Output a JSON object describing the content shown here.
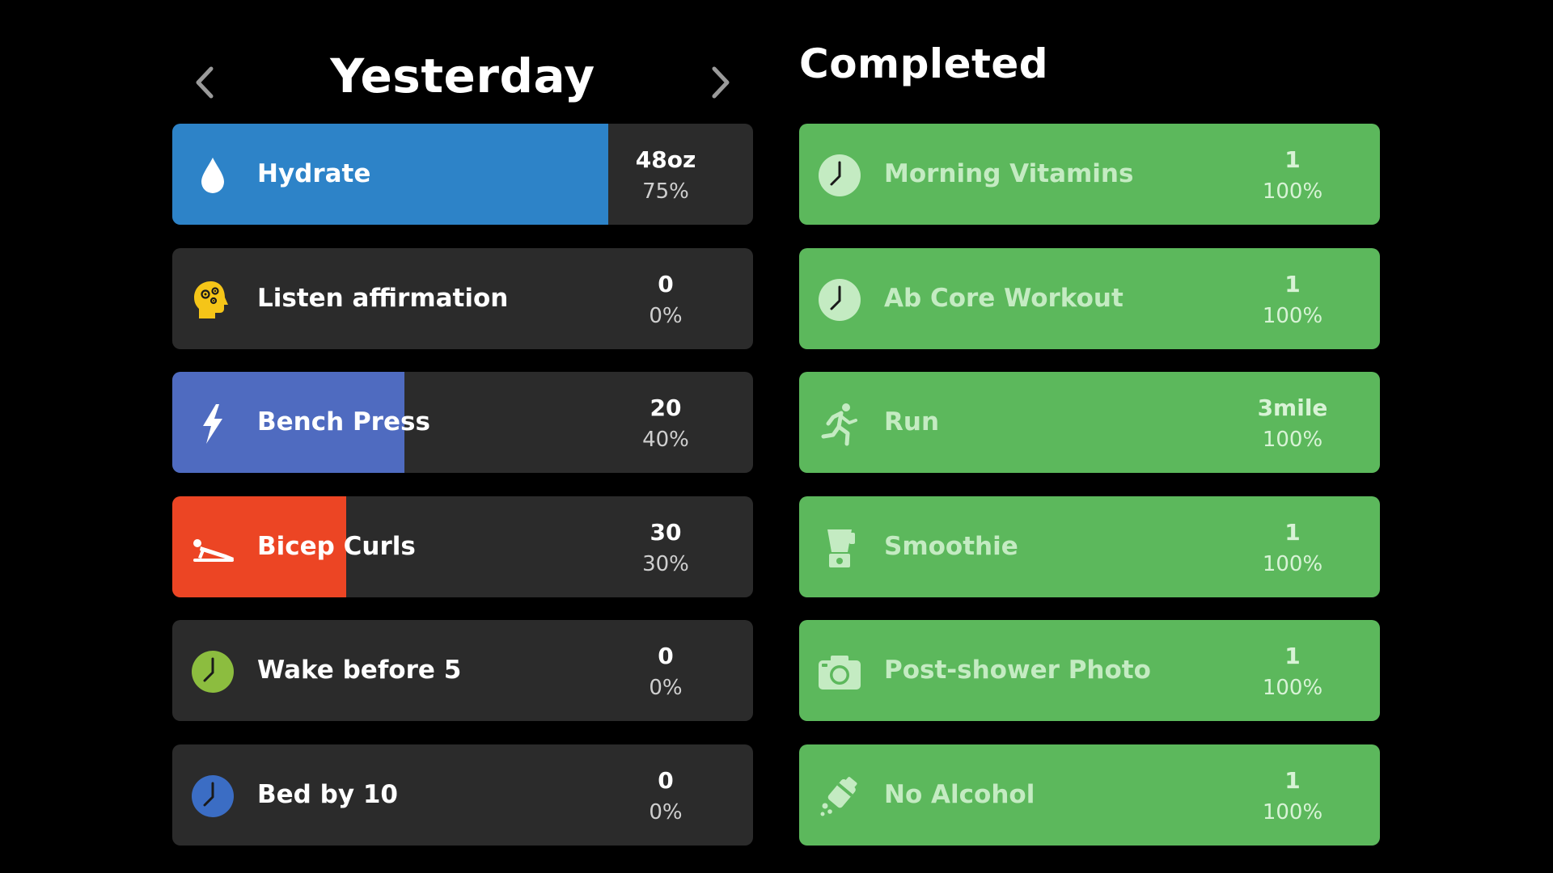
{
  "nav": {
    "title": "Yesterday",
    "prev_icon": "chevron-left-icon",
    "next_icon": "chevron-right-icon"
  },
  "completed_title": "Completed",
  "colors": {
    "background": "#000000",
    "card": "#2b2b2b",
    "completed_green": "#5cb85c"
  },
  "pending": [
    {
      "name": "Hydrate",
      "count": "48oz",
      "pct": "75%",
      "progress": 0.75,
      "color": "#2d83c8",
      "icon": "water-drop-icon"
    },
    {
      "name": "Listen affirmation",
      "count": "0",
      "pct": "0%",
      "progress": 0,
      "color": "#f5c518",
      "icon": "head-gears-icon"
    },
    {
      "name": "Bench Press",
      "count": "20",
      "pct": "40%",
      "progress": 0.4,
      "color": "#4f6bc0",
      "icon": "lightning-icon"
    },
    {
      "name": "Bicep Curls",
      "count": "30",
      "pct": "30%",
      "progress": 0.3,
      "color": "#ec4524",
      "icon": "pushup-icon"
    },
    {
      "name": "Wake before 5",
      "count": "0",
      "pct": "0%",
      "progress": 0,
      "color": "#8cbd3f",
      "icon": "clock-icon"
    },
    {
      "name": "Bed by 10",
      "count": "0",
      "pct": "0%",
      "progress": 0,
      "color": "#3b6dc4",
      "icon": "clock-icon"
    }
  ],
  "completed": [
    {
      "name": "Morning Vitamins",
      "count": "1",
      "pct": "100%",
      "icon": "clock-icon"
    },
    {
      "name": "Ab Core Workout",
      "count": "1",
      "pct": "100%",
      "icon": "clock-icon"
    },
    {
      "name": "Run",
      "count": "3mile",
      "pct": "100%",
      "icon": "runner-icon"
    },
    {
      "name": "Smoothie",
      "count": "1",
      "pct": "100%",
      "icon": "blender-icon"
    },
    {
      "name": "Post-shower Photo",
      "count": "1",
      "pct": "100%",
      "icon": "camera-icon"
    },
    {
      "name": "No Alcohol",
      "count": "1",
      "pct": "100%",
      "icon": "no-alcohol-icon"
    }
  ]
}
